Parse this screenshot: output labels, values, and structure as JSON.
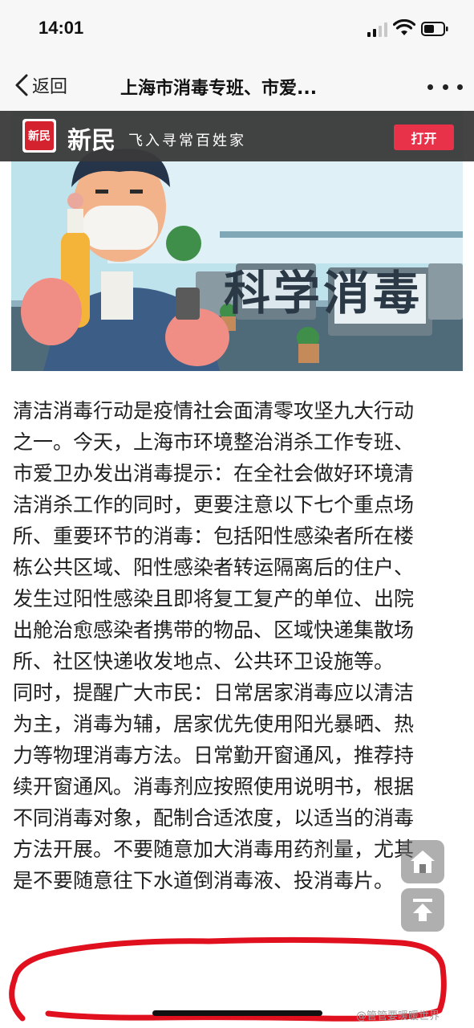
{
  "status_bar": {
    "time": "14:01"
  },
  "nav": {
    "back_label": "返回",
    "title": "上海市消毒专班、市爱..."
  },
  "app_banner": {
    "logo_text": "新民",
    "name": "新民",
    "slogan": "飞入寻常百姓家",
    "open_label": "打开",
    "accent_color": "#e8324a"
  },
  "hero": {
    "headline": "科学消毒"
  },
  "article": {
    "paragraph1_lines": [
      "清洁消毒行动是疫情社会面清零攻坚九大行动",
      "之一。今天，上海市环境整治消杀工作专班、",
      "市爱卫办发出消毒提示：在全社会做好环境清",
      "洁消杀工作的同时，更要注意以下七个重点场",
      "所、重要环节的消毒：包括阳性感染者所在楼",
      "栋公共区域、阳性感染者转运隔离后的住户、",
      "发生过阳性感染且即将复工复产的单位、出院",
      "出舱治愈感染者携带的物品、区域快递集散场",
      "所、社区快递收发地点、公共环卫设施等。"
    ],
    "paragraph2_lines": [
      "同时，提醒广大市民：日常居家消毒应以清洁",
      "为主，消毒为辅，居家优先使用阳光暴晒、热",
      "力等物理消毒方法。日常勤开窗通风，推荐持",
      "续开窗通风。消毒剂应按照使用说明书，根据",
      "不同消毒对象，配制合适浓度，以适当的消毒",
      "方法开展。不要随意加大消毒用药剂量，尤其",
      "是不要随意往下水道倒消毒液、投消毒片。"
    ]
  },
  "floating": {
    "home_icon": "home-icon",
    "top_icon": "arrow-up-icon"
  },
  "watermark": "@管管要暖暖世界",
  "annotation_color": "#e0101e"
}
